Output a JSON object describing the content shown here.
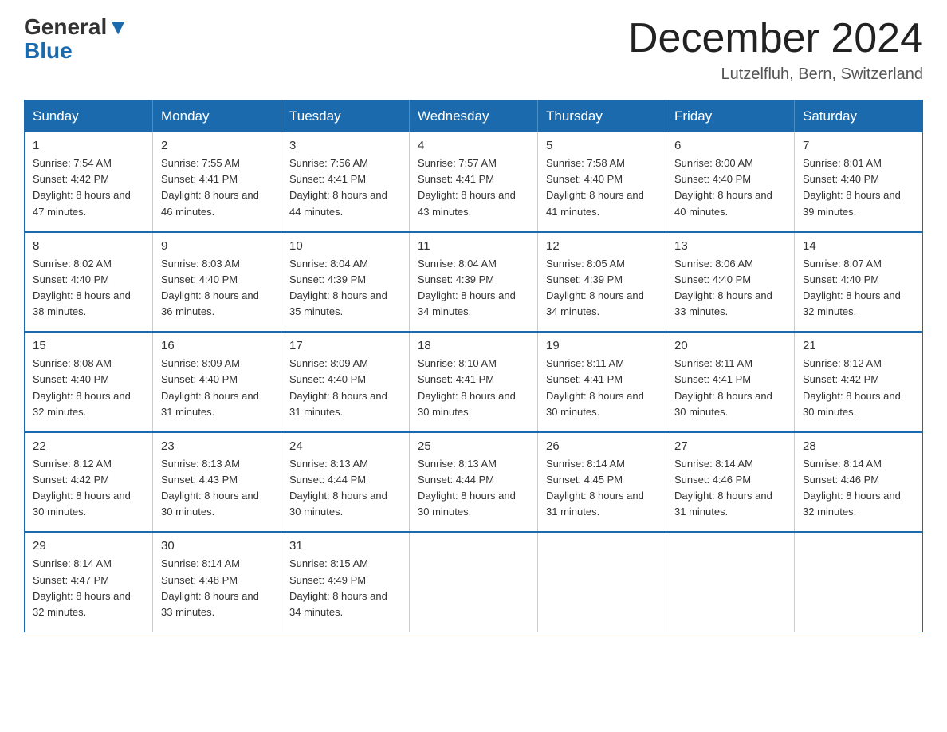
{
  "logo": {
    "general": "General",
    "blue": "Blue"
  },
  "title": "December 2024",
  "location": "Lutzelfluh, Bern, Switzerland",
  "headers": [
    "Sunday",
    "Monday",
    "Tuesday",
    "Wednesday",
    "Thursday",
    "Friday",
    "Saturday"
  ],
  "weeks": [
    [
      {
        "day": "1",
        "sunrise": "7:54 AM",
        "sunset": "4:42 PM",
        "daylight": "8 hours and 47 minutes."
      },
      {
        "day": "2",
        "sunrise": "7:55 AM",
        "sunset": "4:41 PM",
        "daylight": "8 hours and 46 minutes."
      },
      {
        "day": "3",
        "sunrise": "7:56 AM",
        "sunset": "4:41 PM",
        "daylight": "8 hours and 44 minutes."
      },
      {
        "day": "4",
        "sunrise": "7:57 AM",
        "sunset": "4:41 PM",
        "daylight": "8 hours and 43 minutes."
      },
      {
        "day": "5",
        "sunrise": "7:58 AM",
        "sunset": "4:40 PM",
        "daylight": "8 hours and 41 minutes."
      },
      {
        "day": "6",
        "sunrise": "8:00 AM",
        "sunset": "4:40 PM",
        "daylight": "8 hours and 40 minutes."
      },
      {
        "day": "7",
        "sunrise": "8:01 AM",
        "sunset": "4:40 PM",
        "daylight": "8 hours and 39 minutes."
      }
    ],
    [
      {
        "day": "8",
        "sunrise": "8:02 AM",
        "sunset": "4:40 PM",
        "daylight": "8 hours and 38 minutes."
      },
      {
        "day": "9",
        "sunrise": "8:03 AM",
        "sunset": "4:40 PM",
        "daylight": "8 hours and 36 minutes."
      },
      {
        "day": "10",
        "sunrise": "8:04 AM",
        "sunset": "4:39 PM",
        "daylight": "8 hours and 35 minutes."
      },
      {
        "day": "11",
        "sunrise": "8:04 AM",
        "sunset": "4:39 PM",
        "daylight": "8 hours and 34 minutes."
      },
      {
        "day": "12",
        "sunrise": "8:05 AM",
        "sunset": "4:39 PM",
        "daylight": "8 hours and 34 minutes."
      },
      {
        "day": "13",
        "sunrise": "8:06 AM",
        "sunset": "4:40 PM",
        "daylight": "8 hours and 33 minutes."
      },
      {
        "day": "14",
        "sunrise": "8:07 AM",
        "sunset": "4:40 PM",
        "daylight": "8 hours and 32 minutes."
      }
    ],
    [
      {
        "day": "15",
        "sunrise": "8:08 AM",
        "sunset": "4:40 PM",
        "daylight": "8 hours and 32 minutes."
      },
      {
        "day": "16",
        "sunrise": "8:09 AM",
        "sunset": "4:40 PM",
        "daylight": "8 hours and 31 minutes."
      },
      {
        "day": "17",
        "sunrise": "8:09 AM",
        "sunset": "4:40 PM",
        "daylight": "8 hours and 31 minutes."
      },
      {
        "day": "18",
        "sunrise": "8:10 AM",
        "sunset": "4:41 PM",
        "daylight": "8 hours and 30 minutes."
      },
      {
        "day": "19",
        "sunrise": "8:11 AM",
        "sunset": "4:41 PM",
        "daylight": "8 hours and 30 minutes."
      },
      {
        "day": "20",
        "sunrise": "8:11 AM",
        "sunset": "4:41 PM",
        "daylight": "8 hours and 30 minutes."
      },
      {
        "day": "21",
        "sunrise": "8:12 AM",
        "sunset": "4:42 PM",
        "daylight": "8 hours and 30 minutes."
      }
    ],
    [
      {
        "day": "22",
        "sunrise": "8:12 AM",
        "sunset": "4:42 PM",
        "daylight": "8 hours and 30 minutes."
      },
      {
        "day": "23",
        "sunrise": "8:13 AM",
        "sunset": "4:43 PM",
        "daylight": "8 hours and 30 minutes."
      },
      {
        "day": "24",
        "sunrise": "8:13 AM",
        "sunset": "4:44 PM",
        "daylight": "8 hours and 30 minutes."
      },
      {
        "day": "25",
        "sunrise": "8:13 AM",
        "sunset": "4:44 PM",
        "daylight": "8 hours and 30 minutes."
      },
      {
        "day": "26",
        "sunrise": "8:14 AM",
        "sunset": "4:45 PM",
        "daylight": "8 hours and 31 minutes."
      },
      {
        "day": "27",
        "sunrise": "8:14 AM",
        "sunset": "4:46 PM",
        "daylight": "8 hours and 31 minutes."
      },
      {
        "day": "28",
        "sunrise": "8:14 AM",
        "sunset": "4:46 PM",
        "daylight": "8 hours and 32 minutes."
      }
    ],
    [
      {
        "day": "29",
        "sunrise": "8:14 AM",
        "sunset": "4:47 PM",
        "daylight": "8 hours and 32 minutes."
      },
      {
        "day": "30",
        "sunrise": "8:14 AM",
        "sunset": "4:48 PM",
        "daylight": "8 hours and 33 minutes."
      },
      {
        "day": "31",
        "sunrise": "8:15 AM",
        "sunset": "4:49 PM",
        "daylight": "8 hours and 34 minutes."
      },
      null,
      null,
      null,
      null
    ]
  ]
}
